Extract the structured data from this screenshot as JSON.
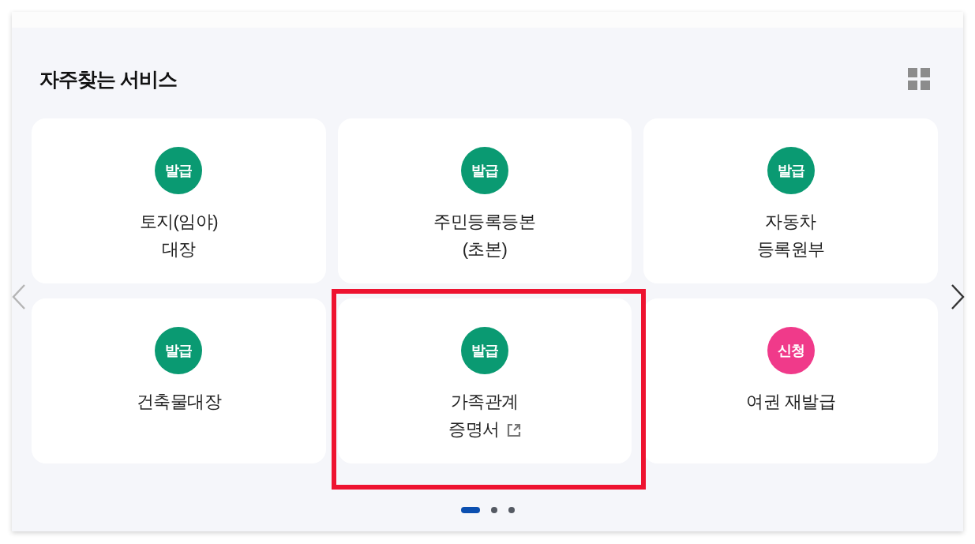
{
  "section": {
    "title": "자주찾는 서비스"
  },
  "prev_button": {
    "disabled": true
  },
  "next_button": {
    "disabled": false
  },
  "cards": [
    {
      "badge": {
        "text": "발급",
        "color": "#0a9a72"
      },
      "label_lines": [
        "토지(임야)",
        "대장"
      ],
      "external_link": false,
      "highlighted": false
    },
    {
      "badge": {
        "text": "발급",
        "color": "#0a9a72"
      },
      "label_lines": [
        "주민등록등본",
        "(초본)"
      ],
      "external_link": false,
      "highlighted": false
    },
    {
      "badge": {
        "text": "발급",
        "color": "#0a9a72"
      },
      "label_lines": [
        "자동차",
        "등록원부"
      ],
      "external_link": false,
      "highlighted": false
    },
    {
      "badge": {
        "text": "발급",
        "color": "#0a9a72"
      },
      "label_lines": [
        "건축물대장"
      ],
      "external_link": false,
      "highlighted": false
    },
    {
      "badge": {
        "text": "발급",
        "color": "#0a9a72"
      },
      "label_lines": [
        "가족관계",
        "증명서"
      ],
      "external_link": true,
      "highlighted": true
    },
    {
      "badge": {
        "text": "신청",
        "color": "#f03a8a"
      },
      "label_lines": [
        "여권 재발급"
      ],
      "external_link": false,
      "highlighted": false
    }
  ],
  "pages": [
    {
      "selected": true
    },
    {
      "selected": false
    },
    {
      "selected": false
    }
  ]
}
